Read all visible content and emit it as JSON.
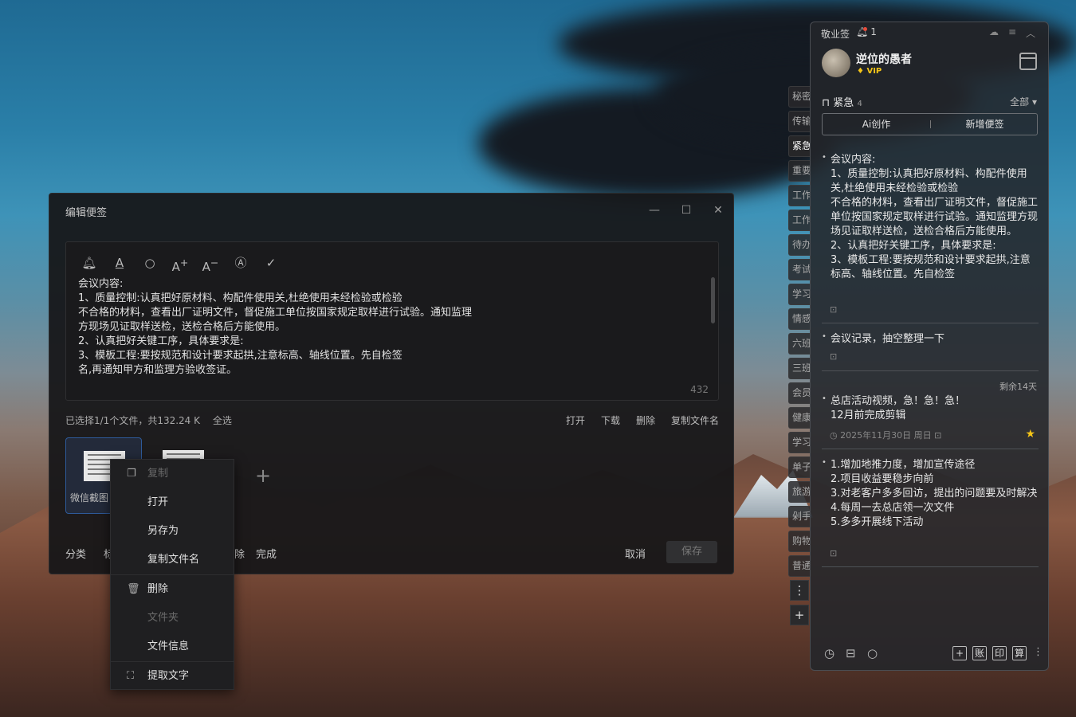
{
  "editor": {
    "title": "编辑便签",
    "window_controls": [
      "minimize-icon",
      "maximize-icon",
      "close-icon"
    ],
    "toolbar_icons": [
      "bell-icon",
      "text-color-icon",
      "search-icon",
      "font-increase-icon",
      "font-decrease-icon",
      "ai-icon",
      "check-icon"
    ],
    "content": "会议内容:\n1、质量控制:认真把好原材料、构配件使用关,杜绝使用未经检验或检验\n不合格的材料，查看出厂证明文件，督促施工单位按国家规定取样进行试验。通知监理\n方现场见证取样送检，送检合格后方能使用。\n2、认真把好关键工序，具体要求是:\n3、模板工程:要按规范和设计要求起拱,注意标高、轴线位置。先自检签\n名,再通知甲方和监理方验收签证。",
    "char_count": "432",
    "file_info": "已选择1/1个文件，共132.24 K",
    "select_all": "全选",
    "file_actions": [
      "打开",
      "下载",
      "删除",
      "复制文件名"
    ],
    "files": [
      {
        "name": "微信截图"
      },
      {
        "name": ""
      }
    ],
    "bottom_left": [
      "分类",
      "标",
      "除",
      "完成"
    ],
    "cancel": "取消",
    "save": "保存"
  },
  "context_menu": {
    "items": [
      {
        "label": "复制",
        "disabled": true,
        "icon": "copy-icon"
      },
      {
        "label": "打开",
        "disabled": false,
        "icon": ""
      },
      {
        "label": "另存为",
        "disabled": false,
        "icon": ""
      },
      {
        "label": "复制文件名",
        "disabled": false,
        "icon": ""
      },
      {
        "label": "删除",
        "disabled": false,
        "icon": "trash-icon"
      },
      {
        "label": "文件夹",
        "disabled": true,
        "icon": ""
      },
      {
        "label": "文件信息",
        "disabled": false,
        "icon": ""
      },
      {
        "label": "提取文字",
        "disabled": false,
        "icon": "scan-text-icon"
      }
    ]
  },
  "side_tabs": [
    "秘密",
    "传输",
    "紧急",
    "重要",
    "工作",
    "工作",
    "待办",
    "考试",
    "学习",
    "情感",
    "六班",
    "三班",
    "会员",
    "健康",
    "学习",
    "单子",
    "旅游",
    "剁手",
    "购物",
    "普通"
  ],
  "panel": {
    "app_name": "敬业签",
    "notif_count": "1",
    "user": {
      "name": "逆位的愚者",
      "badge": "VIP"
    },
    "section": {
      "name": "紧急",
      "count": "4"
    },
    "filter": "全部",
    "ai_btn": "Ai创作",
    "add_btn": "新增便签",
    "notes": [
      {
        "text": "会议内容:\n1、质量控制:认真把好原材料、构配件使用关,杜绝使用未经检验或检验\n不合格的材料，查看出厂证明文件，督促施工单位按国家规定取样进行试验。通知监理方现场见证取样送检，送检合格后方能使用。\n2、认真把好关键工序，具体要求是:\n3、模板工程:要按规范和设计要求起拱,注意标高、轴线位置。先自检签"
      },
      {
        "text": "会议记录，抽空整理一下"
      },
      {
        "remaining": "剩余14天",
        "text": "总店活动视频，急！急！急！\n12月前完成剪辑",
        "date": "2025年11月30日 周日"
      },
      {
        "text": "1.增加地推力度，增加宣传途径\n2.项目收益要稳步向前\n3.对老客户多多回访，提出的问题要及时解决\n4.每周一去总店领一次文件\n5.多多开展线下活动"
      }
    ],
    "bottom_icons": [
      "clock-icon",
      "archive-icon",
      "search-icon"
    ],
    "bottom_boxes": [
      "+",
      "账",
      "印",
      "算"
    ]
  },
  "colors": {
    "star": "#f5c518",
    "panel_bg": "#23252a",
    "editor_bg": "#161618"
  }
}
